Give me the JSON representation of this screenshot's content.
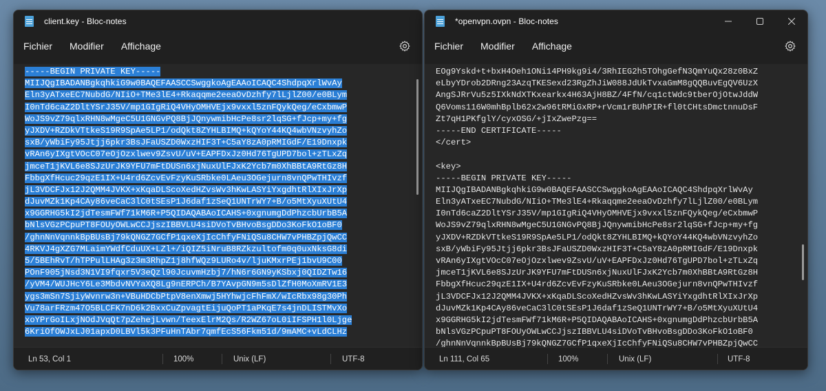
{
  "windows": [
    {
      "title": "client.key - Bloc-notes",
      "menu": [
        "Fichier",
        "Modifier",
        "Affichage"
      ],
      "lines": [
        "-----BEGIN PRIVATE KEY-----",
        "MIIJQgIBADANBgkqhkiG9w0BAQEFAASCCSwggkoAgEAAoICAQC4ShdpqXrlWvAy",
        "Eln3yATxeEC7NubdG/NIiO+TMe3lE4+Rkaqqme2eeaOvDzhfy7lLjlZ00/e0BLym",
        "I0nTd6caZ2DltYSrJ35V/mp1GIgRiQ4VHyOMHVEjx9vxxl5znFQykQeg/eCxbmwP",
        "WoJS9vZ79qlxRHN8wMgeC5U1GNGvPQ8BjJQnywmibHcPe8sr2lqSG+fJcp+my+fg",
        "yJXDV+RZDkVTtkeS19R9SpAe5LP1/odQkt8ZYHLBIMQ+kQYoY44KQ4wbVNzvyhZo",
        "sxB/yWbiFy95Jtjj6pkr3BsJFaUSZD0WxzHIF3T+C5aY8zA0pRMIGdF/E19Dnxpk",
        "vRAn6yIXgtVOcC07eOjOzxlwev9ZsvU/uV+EAPFDxJz0Hd76TgUPD7bol+zTLxZq",
        "jmceT1jKVL6e8SJzUrJK9YFU7mFtDUSn6xjNuxUlFJxK2Ycb7m0XhBBtA9RtGz8H",
        "FbbgXfHcuc29qzE1IX+U4rd6ZcvEvFzyKuSRbke0LAeu3OGejurn8vnQPwTHIvzf",
        "jL3VDCFJx12J2QMM4JVKX+xKqaDLScoXedHZvsWv3hKwLASYiYxgdhtRlXIxJrXp",
        "dJuvMZk1Kp4CAy86veCaC3lC0tSEsP1J6daf1zSeQ1UNTrWY7+B/o5MtXyuXUtU4",
        "x9GGRHG5kI2jdTesmFWf71kM6R+P5QIDAQABAoICAHS+0xgnumgDdPhzcbUrbB5A",
        "bNlsVGzPCpuPT8FOUyOWLwCCJjszIBBVLU4siDVoTvBHvoBsgDDo3KoFkO1oBF0",
        "/ghnNnVqnnkBpBUsBj79kQNGZ7GCfP1qxeXjIcChfyFNiQSu8CHW7vPHBZpjQwCC",
        "4RKVJ4gXZG7MLaimYWdfCduUX+LZl+/iQIZ5iNruB8RZkzultofm0q0uxNksG8di",
        "5/5BEhRvT/hTPPulLHAg3z3m3RhpZ1j8hfWQz9LURo4v/ljuKMxrPEj1bvU9C00",
        "POnF905jNsd3N1VI9fqxr5V3eQzl90JcuvmHzbj7/hN6r6GN9yKSbxj0QIDZTw16",
        "/yVM4/WUJHcY6Le3MbdvNVYaXQ8Lg9nERPCh/B7YAvpGN9m5sDlZfH0MoXmRV1E3",
        "ygs3mSn7SjiyWvnrw3n+VBuHDCbPtpV8enXmwj5HYhwjcFhFmX/wIcRbx98g30Ph",
        "Vu78arFRzm47O5BLCFK7nD6k2BxxCuZpvagtEijuQoPT1aPKqE7s4jnDLISTMvXo",
        "xoYPrGoILxjNOdJVqQt7pZehejLvwn/TeexElrM2Qs/R2WZ67oL0iIFSPH1l0Ljge",
        "6KriOfOWJxLJ01apxD0LBVl5k3PFuHnTAbr7qmfEcS56Fkm51d/9mAMC+vLdCLHz"
      ],
      "selected_lines": 23,
      "status": {
        "position": "Ln 53, Col 1",
        "zoom": "100%",
        "eol": "Unix (LF)",
        "encoding": "UTF-8"
      }
    },
    {
      "title": "*openvpn.ovpn - Bloc-notes",
      "menu": [
        "Fichier",
        "Modifier",
        "Affichage"
      ],
      "lines": [
        "EOg9Yskd+t+bxH4Oeh1ONi14PH9kg9i4/3RhIEG2h5TOhgGefN3QmYuQx28z0BxZ",
        "eLbyYDrob2DRng23AzqTKESexd23RgZhJiW088JdUkTvxaGmM8gQQBuvEgQV6UzX",
        "AngSJRrVu5z5IXkNdXTKxearkx4H63AjH8BZ/4FfN/cq1ctWdc9tberOjOtwJddW",
        "Q6Voms116W0mhBplb62x2w96tRMiGxRP+rVcm1rBUhPIR+fl0tCHtsDmctnnuDsF",
        "Zt7qH1PKfglY/cyxOSG/+jIxZwePzg==",
        "-----END CERTIFICATE-----",
        "</cert>",
        "",
        "<key>",
        "-----BEGIN PRIVATE KEY-----",
        "MIIJQgIBADANBgkqhkiG9w0BAQEFAASCCSwggkoAgEAAoICAQC4ShdpqXrlWvAy",
        "Eln3yATxeEC7NubdG/NIiO+TMe3lE4+Rkaqqme2eeaOvDzhfy7lLjlZ00/e0BLym",
        "I0nTd6caZ2DltYSrJ35V/mp1GIgRiQ4VHyOMHVEjx9vxxl5znFQykQeg/eCxbmwP",
        "WoJS9vZ79qlxRHN8wMgeC5U1GNGvPQ8BjJQnywmibHcPe8sr2lqSG+fJcp+my+fg",
        "yJXDV+RZDkVTtkeS19R9SpAe5LP1/odQkt8ZYHLBIMQ+kQYoY44KQ4wbVNzvyhZo",
        "sxB/yWbiFy95Jtjj6pkr3BsJFaUSZD0WxzHIF3T+C5aY8zA0pRMIGdF/E19Dnxpk",
        "vRAn6yIXgtVOcC07eOjOzxlwev9ZsvU/uV+EAPFDxJz0Hd76TgUPD7bol+zTLxZq",
        "jmceT1jKVL6e8SJzUrJK9YFU7mFtDUSn6xjNuxUlFJxK2Ycb7m0XhBBtA9RtGz8H",
        "FbbgXfHcuc29qzE1IX+U4rd6ZcvEvFzyKuSRbke0LAeu3OGejurn8vnQPwTHIvzf",
        "jL3VDCFJx12J2QMM4JVKX+xKqaDLScoXedHZvsWv3hKwLASYiYxgdhtRlXIxJrXp",
        "dJuvMZk1Kp4CAy86veCaC3lC0tSEsP1J6daf1zSeQ1UNTrWY7+B/o5MtXyuXUtU4",
        "x9GGRHG5kI2jdTesmFWf71kM6R+P5QIDAQABAoICAHS+0xgnumgDdPhzcbUrbB5A",
        "bNlsVGzPCpuPT8FOUyOWLwCCJjszIBBVLU4siDVoTvBHvoBsgDDo3KoFkO1oBF0",
        "/ghnNnVqnnkBpBUsBj79kQNGZ7GCfP1qxeXjIcChfyFNiQSu8CHW7vPHBZpjQwCC"
      ],
      "selected_lines": 0,
      "status": {
        "position": "Ln 111, Col 65",
        "zoom": "100%",
        "eol": "Unix (LF)",
        "encoding": "UTF-8"
      }
    }
  ],
  "icons": {
    "app": "notepad-icon",
    "settings": "gear-icon",
    "minimize": "minimize-icon",
    "maximize": "maximize-icon",
    "close": "close-icon"
  },
  "colors": {
    "selection": "#2b7fd6",
    "background": "#272727",
    "chrome": "#202020"
  }
}
